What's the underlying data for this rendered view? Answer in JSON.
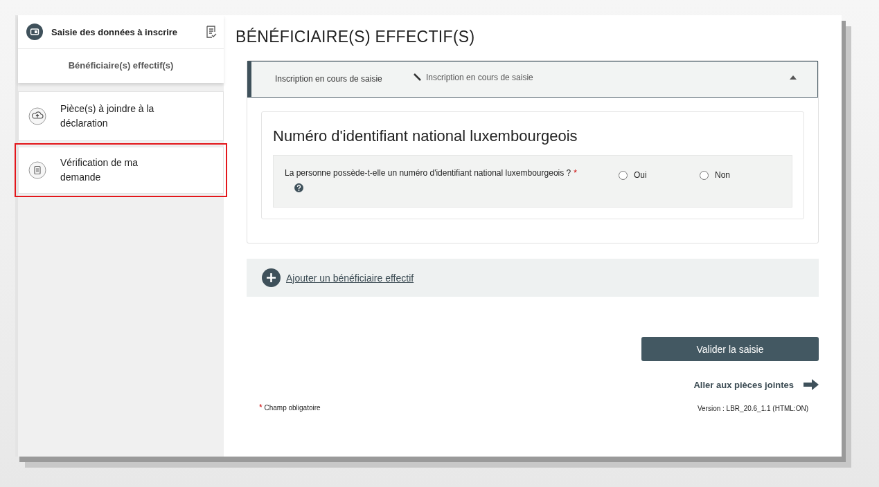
{
  "sidebar": {
    "step": {
      "title": "Saisie des données à inscrire",
      "sub_item": "Bénéficiaire(s) effectif(s)"
    },
    "items": [
      {
        "kind": "upload",
        "label": "Pièce(s) à joindre à la déclaration",
        "highlighted": false
      },
      {
        "kind": "clipboard",
        "label": "Vérification de ma demande",
        "highlighted": true
      }
    ]
  },
  "page_title": "BÉNÉFICIAIRE(S) EFFECTIF(S)",
  "status_panel": {
    "label": "Inscription en cours de saisie",
    "status": "Inscription en cours de saisie",
    "expanded": true
  },
  "section": {
    "title": "Numéro d'identifiant national luxembourgeois",
    "question": "La personne possède-t-elle un numéro d'identifiant national luxembourgeois ?",
    "required_mark": "*",
    "options": [
      {
        "label": "Oui",
        "selected": false
      },
      {
        "label": "Non",
        "selected": false
      }
    ]
  },
  "add_link": "Ajouter un bénéficiaire effectif",
  "validate_button": "Valider la saisie",
  "next_link": "Aller aux pièces jointes",
  "footnote": {
    "mark": "*",
    "text": "Champ obligatoire"
  },
  "version": "Version : LBR_20.6_1.1 (HTML:ON)"
}
